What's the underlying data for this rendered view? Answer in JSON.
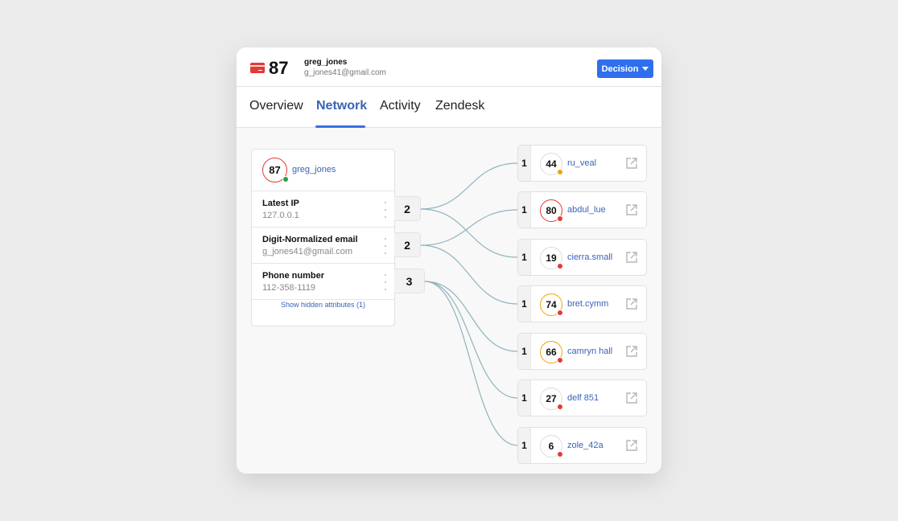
{
  "header": {
    "icon": "credit-card-icon",
    "score": "87",
    "username": "greg_jones",
    "email": "g_jones41@gmail.com",
    "decision_label": "Decision"
  },
  "tabs": [
    {
      "label": "Overview",
      "active": false
    },
    {
      "label": "Network",
      "active": true
    },
    {
      "label": "Activity",
      "active": false
    },
    {
      "label": "Zendesk",
      "active": false
    }
  ],
  "network": {
    "root": {
      "score": "87",
      "name": "greg_jones",
      "ring_color": "#e53935",
      "status_color": "#2e9e3e"
    },
    "attributes": [
      {
        "label": "Latest IP",
        "value": "127.0.0.1",
        "count": "2",
        "links": [
          0,
          2
        ]
      },
      {
        "label": "Digit-Normalized email",
        "value": "g_jones41@gmail.com",
        "count": "2",
        "links": [
          1,
          3
        ]
      },
      {
        "label": "Phone number",
        "value": "112-358-1119",
        "count": "3",
        "links": [
          4,
          5,
          6
        ]
      }
    ],
    "show_hidden_label": "Show hidden attributes (1)",
    "targets": [
      {
        "count": "1",
        "score": "44",
        "name": "ru_veal",
        "ring_color": "#dddddd",
        "status_color": "#f0a500"
      },
      {
        "count": "1",
        "score": "80",
        "name": "abdul_lue",
        "ring_color": "#e53935",
        "status_color": "#e53935"
      },
      {
        "count": "1",
        "score": "19",
        "name": "cierra.small",
        "ring_color": "#dddddd",
        "status_color": "#e53935"
      },
      {
        "count": "1",
        "score": "74",
        "name": "bret.cymm",
        "ring_color": "#f0a500",
        "status_color": "#e53935"
      },
      {
        "count": "1",
        "score": "66",
        "name": "camryn hall",
        "ring_color": "#f0a500",
        "status_color": "#e53935"
      },
      {
        "count": "1",
        "score": "27",
        "name": "delf 851",
        "ring_color": "#dddddd",
        "status_color": "#e53935"
      },
      {
        "count": "1",
        "score": "6",
        "name": "zole_42a",
        "ring_color": "#dddddd",
        "status_color": "#e53935"
      }
    ],
    "link_color": "#8fb3bf",
    "target_icon": "external-link-icon"
  }
}
